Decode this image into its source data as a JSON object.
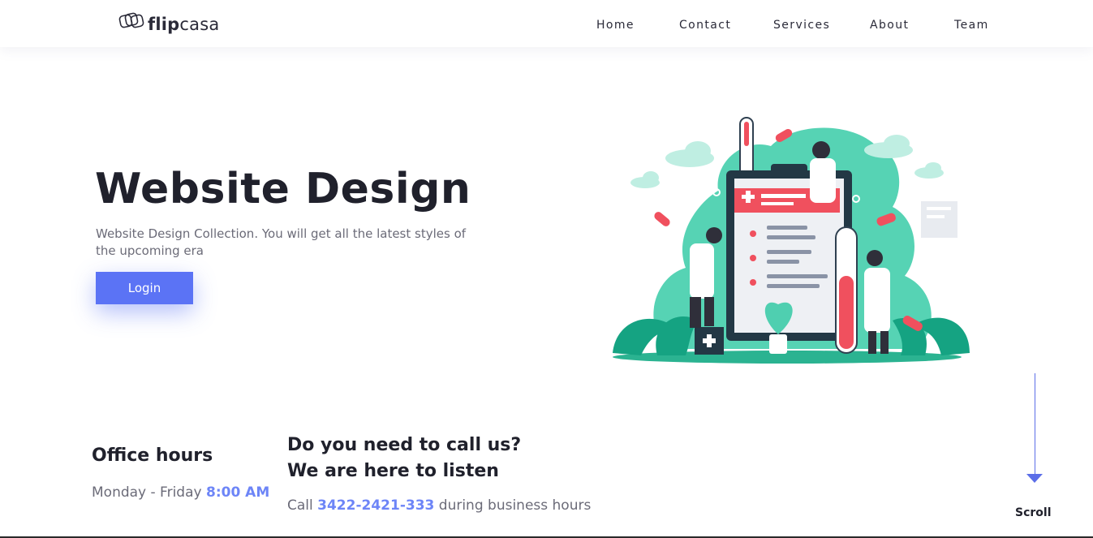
{
  "brand": {
    "name_bold": "flip",
    "name_rest": "casa"
  },
  "nav": {
    "items": [
      {
        "label": "Home"
      },
      {
        "label": "Contact"
      },
      {
        "label": "Services"
      },
      {
        "label": "About"
      },
      {
        "label": "Team"
      }
    ]
  },
  "hero": {
    "title": "Website Design",
    "subtitle": "Website Design Collection. You will get all the latest styles of the upcoming era",
    "login_label": "Login"
  },
  "office": {
    "title": "Office hours",
    "days": "Monday - Friday ",
    "time": "8:00 AM"
  },
  "call": {
    "title_line1": "Do you need to call us?",
    "title_line2": "We are here to listen",
    "prefix": "Call ",
    "phone": "3422-2421-333",
    "suffix": " during business hours"
  },
  "scroll": {
    "label": "Scroll"
  },
  "colors": {
    "accent": "#5b73f5",
    "accent_text": "#6d85f7",
    "illustration_green": "#4fcfb0",
    "illustration_red": "#f0505e"
  }
}
